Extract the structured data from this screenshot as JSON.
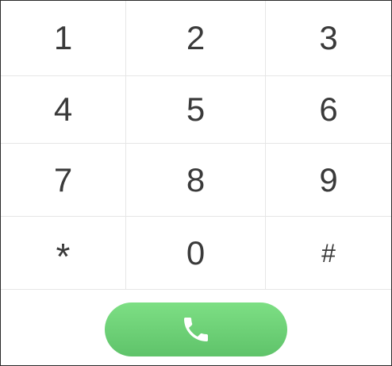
{
  "keypad": {
    "keys": [
      {
        "label": "1"
      },
      {
        "label": "2"
      },
      {
        "label": "3"
      },
      {
        "label": "4"
      },
      {
        "label": "5"
      },
      {
        "label": "6"
      },
      {
        "label": "7"
      },
      {
        "label": "8"
      },
      {
        "label": "9"
      },
      {
        "label": "*"
      },
      {
        "label": "0"
      },
      {
        "label": "#"
      }
    ]
  },
  "call_button": {
    "icon": "phone-icon",
    "color": "#6ad174"
  }
}
